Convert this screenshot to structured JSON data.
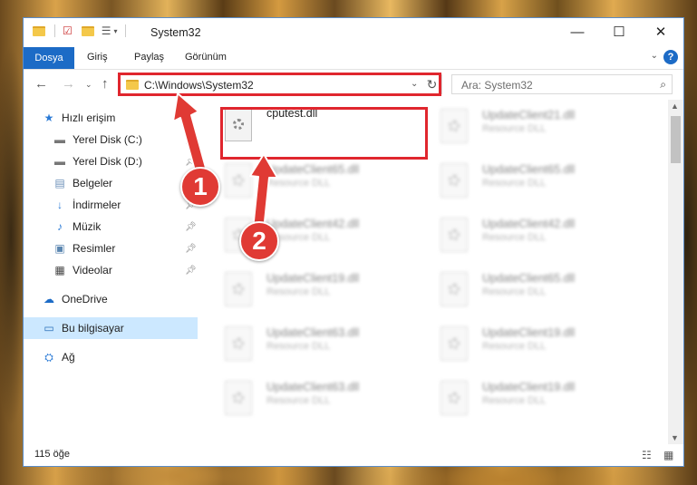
{
  "window": {
    "title": "System32",
    "controls": {
      "minimize": "—",
      "maximize": "☐",
      "close": "✕"
    }
  },
  "ribbon": {
    "file_tab": "Dosya",
    "tabs": [
      "Giriş",
      "Paylaş",
      "Görünüm"
    ],
    "help": "?"
  },
  "address": {
    "path": "C:\\Windows\\System32",
    "search_placeholder": "Ara: System32"
  },
  "sidebar": {
    "items": [
      {
        "label": "Hızlı erişim",
        "icon": "star-icon",
        "pinned": false
      },
      {
        "label": "Yerel Disk (C:)",
        "icon": "drive-icon",
        "pinned": true
      },
      {
        "label": "Yerel Disk (D:)",
        "icon": "drive-icon",
        "pinned": true
      },
      {
        "label": "Belgeler",
        "icon": "documents-icon",
        "pinned": true
      },
      {
        "label": "İndirmeler",
        "icon": "download-icon",
        "pinned": true
      },
      {
        "label": "Müzik",
        "icon": "music-icon",
        "pinned": true
      },
      {
        "label": "Resimler",
        "icon": "pictures-icon",
        "pinned": true
      },
      {
        "label": "Videolar",
        "icon": "video-icon",
        "pinned": true
      },
      {
        "label": "OneDrive",
        "icon": "cloud-icon",
        "pinned": false
      },
      {
        "label": "Bu bilgisayar",
        "icon": "computer-icon",
        "pinned": false,
        "selected": true
      },
      {
        "label": "Ağ",
        "icon": "network-icon",
        "pinned": false
      }
    ]
  },
  "files": {
    "highlighted": {
      "name": "cputest.dll",
      "type": ""
    },
    "blurred": [
      {
        "name": "UpdateClient21.dll",
        "type": "Resource DLL"
      },
      {
        "name": "UpdateClient65.dll",
        "type": "Resource DLL"
      },
      {
        "name": "UpdateClient65.dll",
        "type": "Resource DLL"
      },
      {
        "name": "UpdateClient42.dll",
        "type": "Resource DLL"
      },
      {
        "name": "UpdateClient42.dll",
        "type": "Resource DLL"
      },
      {
        "name": "UpdateClient19.dll",
        "type": "Resource DLL"
      },
      {
        "name": "UpdateClient65.dll",
        "type": "Resource DLL"
      },
      {
        "name": "UpdateClient63.dll",
        "type": "Resource DLL"
      },
      {
        "name": "UpdateClient19.dll",
        "type": "Resource DLL"
      },
      {
        "name": "UpdateClient63.dll",
        "type": "Resource DLL"
      },
      {
        "name": "UpdateClient19.dll",
        "type": "Resource DLL"
      }
    ]
  },
  "status": {
    "item_count": "115 öğe"
  },
  "annotations": {
    "badge1": "1",
    "badge2": "2",
    "color": "#e03a34"
  }
}
